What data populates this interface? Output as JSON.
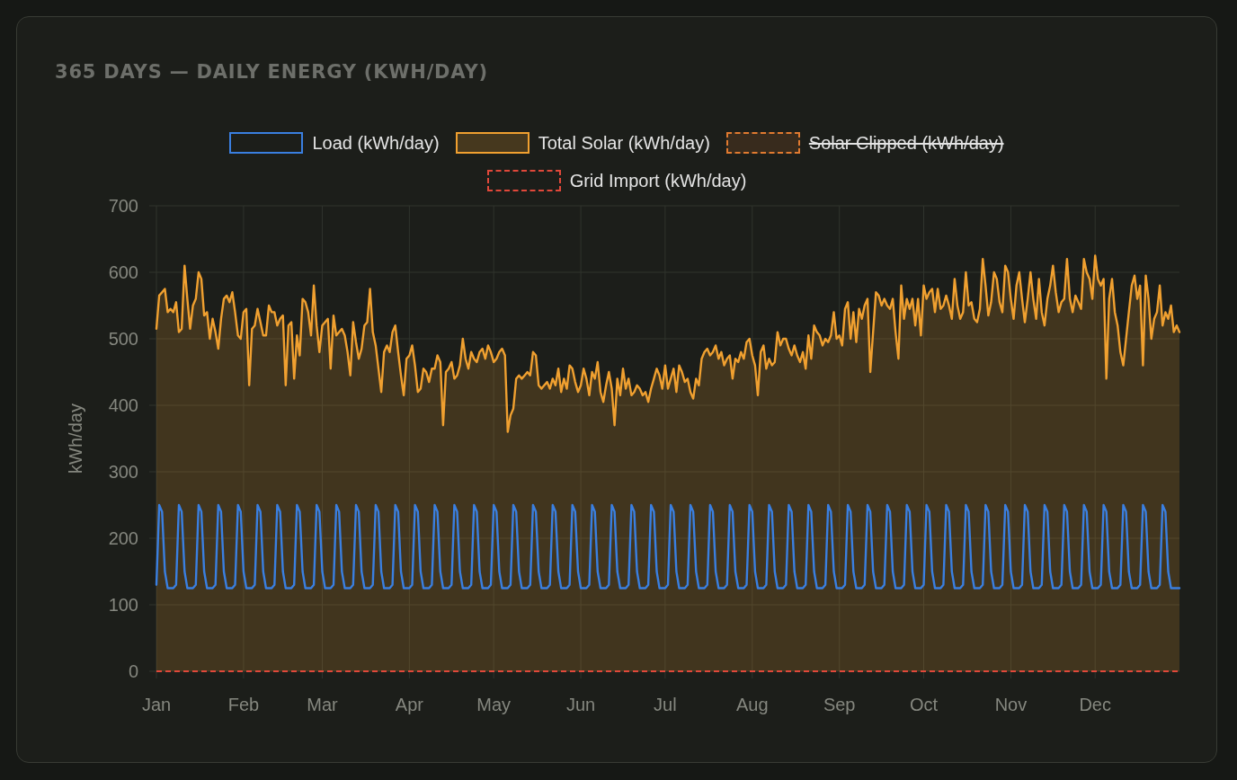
{
  "card": {
    "title": "365 DAYS — DAILY ENERGY (KWH/DAY)",
    "legend": [
      {
        "hidden": false
      },
      {
        "hidden": false
      },
      {
        "hidden": true
      },
      {
        "hidden": false
      }
    ],
    "chart_data": {
      "type": "line",
      "ylabel": "kWh/day",
      "grid": true,
      "ylim": [
        0,
        700
      ],
      "yticks": [
        0,
        100,
        200,
        300,
        400,
        500,
        600,
        700
      ],
      "categories": [
        "Jan",
        null,
        null,
        null,
        null,
        null,
        null,
        null,
        null,
        null,
        null,
        null,
        null,
        null,
        null,
        null,
        null,
        null,
        null,
        null,
        null,
        null,
        null,
        null,
        null,
        null,
        null,
        null,
        null,
        null,
        null,
        "Feb",
        null,
        null,
        null,
        null,
        null,
        null,
        null,
        null,
        null,
        null,
        null,
        null,
        null,
        null,
        null,
        null,
        null,
        null,
        null,
        null,
        null,
        null,
        null,
        null,
        null,
        null,
        null,
        "Mar",
        null,
        null,
        null,
        null,
        null,
        null,
        null,
        null,
        null,
        null,
        null,
        null,
        null,
        null,
        null,
        null,
        null,
        null,
        null,
        null,
        null,
        null,
        null,
        null,
        null,
        null,
        null,
        null,
        null,
        null,
        "Apr",
        null,
        null,
        null,
        null,
        null,
        null,
        null,
        null,
        null,
        null,
        null,
        null,
        null,
        null,
        null,
        null,
        null,
        null,
        null,
        null,
        null,
        null,
        null,
        null,
        null,
        null,
        null,
        null,
        null,
        "May",
        null,
        null,
        null,
        null,
        null,
        null,
        null,
        null,
        null,
        null,
        null,
        null,
        null,
        null,
        null,
        null,
        null,
        null,
        null,
        null,
        null,
        null,
        null,
        null,
        null,
        null,
        null,
        null,
        null,
        null,
        "Jun",
        null,
        null,
        null,
        null,
        null,
        null,
        null,
        null,
        null,
        null,
        null,
        null,
        null,
        null,
        null,
        null,
        null,
        null,
        null,
        null,
        null,
        null,
        null,
        null,
        null,
        null,
        null,
        null,
        null,
        "Jul",
        null,
        null,
        null,
        null,
        null,
        null,
        null,
        null,
        null,
        null,
        null,
        null,
        null,
        null,
        null,
        null,
        null,
        null,
        null,
        null,
        null,
        null,
        null,
        null,
        null,
        null,
        null,
        null,
        null,
        null,
        "Aug",
        null,
        null,
        null,
        null,
        null,
        null,
        null,
        null,
        null,
        null,
        null,
        null,
        null,
        null,
        null,
        null,
        null,
        null,
        null,
        null,
        null,
        null,
        null,
        null,
        null,
        null,
        null,
        null,
        null,
        null,
        "Sep",
        null,
        null,
        null,
        null,
        null,
        null,
        null,
        null,
        null,
        null,
        null,
        null,
        null,
        null,
        null,
        null,
        null,
        null,
        null,
        null,
        null,
        null,
        null,
        null,
        null,
        null,
        null,
        null,
        null,
        "Oct",
        null,
        null,
        null,
        null,
        null,
        null,
        null,
        null,
        null,
        null,
        null,
        null,
        null,
        null,
        null,
        null,
        null,
        null,
        null,
        null,
        null,
        null,
        null,
        null,
        null,
        null,
        null,
        null,
        null,
        null,
        "Nov",
        null,
        null,
        null,
        null,
        null,
        null,
        null,
        null,
        null,
        null,
        null,
        null,
        null,
        null,
        null,
        null,
        null,
        null,
        null,
        null,
        null,
        null,
        null,
        null,
        null,
        null,
        null,
        null,
        null,
        "Dec",
        null,
        null,
        null,
        null,
        null,
        null,
        null,
        null,
        null,
        null,
        null,
        null,
        null,
        null,
        null,
        null,
        null,
        null,
        null,
        null,
        null,
        null,
        null,
        null,
        null,
        null,
        null,
        null,
        null,
        null
      ],
      "series": [
        {
          "name": "Load (kWh/day)",
          "color": "#3a7fe0",
          "type": "line",
          "line_style": "solid",
          "values": [
            130,
            250,
            240,
            150,
            125,
            125,
            125,
            130,
            250,
            240,
            150,
            125,
            125,
            125,
            130,
            250,
            240,
            150,
            125,
            125,
            125,
            130,
            250,
            240,
            150,
            125,
            125,
            125,
            130,
            250,
            240,
            150,
            125,
            125,
            125,
            130,
            250,
            240,
            150,
            125,
            125,
            125,
            130,
            250,
            240,
            150,
            125,
            125,
            125,
            130,
            250,
            240,
            150,
            125,
            125,
            125,
            130,
            250,
            240,
            150,
            125,
            125,
            125,
            130,
            250,
            240,
            150,
            125,
            125,
            125,
            130,
            250,
            240,
            150,
            125,
            125,
            125,
            130,
            250,
            240,
            150,
            125,
            125,
            125,
            130,
            250,
            240,
            150,
            125,
            125,
            125,
            130,
            250,
            240,
            150,
            125,
            125,
            125,
            130,
            250,
            240,
            150,
            125,
            125,
            125,
            130,
            250,
            240,
            150,
            125,
            125,
            125,
            130,
            250,
            240,
            150,
            125,
            125,
            125,
            130,
            250,
            240,
            150,
            125,
            125,
            125,
            130,
            250,
            240,
            150,
            125,
            125,
            125,
            130,
            250,
            240,
            150,
            125,
            125,
            125,
            130,
            250,
            240,
            150,
            125,
            125,
            125,
            130,
            250,
            240,
            150,
            125,
            125,
            125,
            130,
            250,
            240,
            150,
            125,
            125,
            125,
            130,
            250,
            240,
            150,
            125,
            125,
            125,
            130,
            250,
            240,
            150,
            125,
            125,
            125,
            130,
            250,
            240,
            150,
            125,
            125,
            125,
            130,
            250,
            240,
            150,
            125,
            125,
            125,
            130,
            250,
            240,
            150,
            125,
            125,
            125,
            130,
            250,
            240,
            150,
            125,
            125,
            125,
            130,
            250,
            240,
            150,
            125,
            125,
            125,
            130,
            250,
            240,
            150,
            125,
            125,
            125,
            130,
            250,
            240,
            150,
            125,
            125,
            125,
            130,
            250,
            240,
            150,
            125,
            125,
            125,
            130,
            250,
            240,
            150,
            125,
            125,
            125,
            130,
            250,
            240,
            150,
            125,
            125,
            125,
            130,
            250,
            240,
            150,
            125,
            125,
            125,
            130,
            250,
            240,
            150,
            125,
            125,
            125,
            130,
            250,
            240,
            150,
            125,
            125,
            125,
            130,
            250,
            240,
            150,
            125,
            125,
            125,
            130,
            250,
            240,
            150,
            125,
            125,
            125,
            130,
            250,
            240,
            150,
            125,
            125,
            125,
            130,
            250,
            240,
            150,
            125,
            125,
            125,
            130,
            250,
            240,
            150,
            125,
            125,
            125,
            130,
            250,
            240,
            150,
            125,
            125,
            125,
            130,
            250,
            240,
            150,
            125,
            125,
            125,
            130,
            250,
            240,
            150,
            125,
            125,
            125,
            130,
            250,
            240,
            150,
            125,
            125,
            125,
            130,
            250,
            240,
            150,
            125,
            125,
            125,
            130,
            250,
            240,
            150,
            125,
            125,
            125,
            130,
            250,
            240,
            150,
            125,
            125,
            125,
            130,
            250,
            240,
            150,
            125,
            125,
            125,
            130,
            250,
            240,
            150,
            125,
            125,
            125,
            125
          ]
        },
        {
          "name": "Total Solar (kWh/day)",
          "color": "#f0a030",
          "type": "area",
          "line_style": "solid",
          "values": [
            515,
            565,
            570,
            575,
            540,
            545,
            540,
            555,
            510,
            515,
            610,
            560,
            515,
            550,
            560,
            600,
            590,
            535,
            540,
            500,
            530,
            510,
            485,
            530,
            560,
            565,
            555,
            570,
            540,
            505,
            500,
            540,
            545,
            430,
            515,
            520,
            545,
            525,
            505,
            505,
            550,
            540,
            540,
            520,
            530,
            535,
            430,
            520,
            525,
            440,
            505,
            475,
            560,
            555,
            540,
            505,
            580,
            520,
            480,
            520,
            525,
            530,
            455,
            535,
            505,
            510,
            515,
            505,
            480,
            445,
            525,
            495,
            470,
            485,
            520,
            525,
            575,
            510,
            490,
            455,
            420,
            480,
            490,
            480,
            510,
            520,
            480,
            445,
            415,
            470,
            475,
            490,
            460,
            420,
            425,
            455,
            450,
            435,
            455,
            455,
            475,
            465,
            370,
            450,
            455,
            465,
            440,
            445,
            460,
            500,
            470,
            455,
            480,
            470,
            465,
            480,
            485,
            470,
            490,
            480,
            465,
            470,
            480,
            485,
            475,
            360,
            385,
            395,
            440,
            445,
            440,
            445,
            450,
            445,
            480,
            475,
            430,
            425,
            430,
            435,
            425,
            440,
            430,
            455,
            420,
            440,
            425,
            460,
            455,
            435,
            420,
            430,
            455,
            440,
            415,
            450,
            440,
            465,
            420,
            405,
            430,
            450,
            425,
            370,
            440,
            415,
            455,
            425,
            440,
            415,
            420,
            430,
            425,
            415,
            420,
            405,
            425,
            440,
            455,
            445,
            425,
            460,
            425,
            440,
            455,
            420,
            460,
            450,
            435,
            440,
            420,
            410,
            440,
            430,
            470,
            480,
            485,
            475,
            480,
            490,
            470,
            480,
            460,
            470,
            475,
            440,
            470,
            465,
            480,
            470,
            495,
            500,
            475,
            460,
            415,
            480,
            490,
            455,
            470,
            460,
            465,
            510,
            490,
            500,
            500,
            485,
            475,
            490,
            475,
            465,
            480,
            455,
            505,
            470,
            520,
            510,
            505,
            490,
            500,
            495,
            505,
            540,
            500,
            505,
            490,
            545,
            555,
            500,
            540,
            495,
            545,
            530,
            550,
            560,
            450,
            510,
            570,
            565,
            550,
            560,
            550,
            545,
            560,
            510,
            470,
            580,
            530,
            560,
            545,
            560,
            520,
            560,
            505,
            580,
            560,
            570,
            575,
            540,
            575,
            545,
            550,
            565,
            550,
            530,
            590,
            550,
            530,
            540,
            600,
            550,
            555,
            530,
            525,
            545,
            620,
            580,
            535,
            555,
            600,
            590,
            555,
            540,
            610,
            600,
            560,
            530,
            580,
            600,
            560,
            525,
            560,
            600,
            560,
            530,
            590,
            540,
            520,
            560,
            580,
            610,
            570,
            540,
            555,
            560,
            620,
            560,
            540,
            565,
            555,
            545,
            620,
            600,
            590,
            560,
            625,
            590,
            580,
            590,
            440,
            560,
            590,
            540,
            520,
            480,
            460,
            500,
            540,
            580,
            595,
            560,
            580,
            460,
            595,
            560,
            500,
            530,
            540,
            580,
            520,
            540,
            530,
            550,
            510,
            520,
            510
          ]
        },
        {
          "name": "Solar Clipped (kWh/day)",
          "color": "#e07a30",
          "type": "area",
          "line_style": "dashed",
          "values": [
            null,
            null,
            null,
            null,
            null,
            null,
            null,
            null,
            null,
            null,
            null,
            null,
            null,
            null,
            null,
            null,
            null,
            null,
            null,
            null,
            null,
            null,
            null,
            null,
            null,
            null,
            null,
            null,
            null,
            null,
            null,
            null,
            null,
            null,
            null,
            null,
            null,
            null,
            null,
            null,
            null,
            null,
            null,
            null,
            null,
            null,
            null,
            null,
            null,
            null,
            null,
            null,
            null,
            null,
            null,
            null,
            null,
            null,
            null,
            null,
            null,
            null,
            null,
            null,
            null,
            null,
            null,
            null,
            null,
            null,
            null,
            null,
            null,
            null,
            null,
            null,
            null,
            null,
            null,
            null,
            null,
            null,
            null,
            null,
            null,
            null,
            null,
            null,
            null,
            null,
            null,
            null,
            null,
            null,
            null,
            null,
            null,
            null,
            null,
            null,
            null,
            null,
            null,
            null,
            null,
            null,
            null,
            null,
            null,
            null,
            null,
            null,
            null,
            null,
            null,
            null,
            null,
            null,
            null,
            null,
            null,
            null,
            null,
            null,
            null,
            null,
            null,
            null,
            null,
            null,
            null,
            null,
            null,
            null,
            null,
            null,
            null,
            null,
            null,
            null,
            null,
            null,
            null,
            null,
            null,
            null,
            null,
            null,
            null,
            null,
            null,
            null,
            null,
            null,
            null,
            null,
            null,
            null,
            null,
            null,
            null,
            null,
            null,
            null,
            null,
            null,
            null,
            null,
            null,
            null,
            null,
            null,
            null,
            null,
            null,
            null,
            null,
            null,
            null,
            null,
            null,
            null,
            null,
            null,
            null,
            null,
            null,
            null,
            null,
            null,
            null,
            null,
            null,
            null,
            null,
            null,
            null,
            null,
            null,
            null,
            null,
            null,
            null,
            null,
            null,
            null,
            null,
            null,
            null,
            null,
            null,
            null,
            null,
            null,
            null,
            null,
            null,
            null,
            null,
            null,
            null,
            null,
            null,
            null,
            null,
            null,
            null,
            null,
            null,
            null,
            null,
            null,
            null,
            null,
            null,
            null,
            null,
            null,
            null,
            null,
            null,
            null,
            null,
            null,
            null,
            null,
            null,
            null,
            null,
            null,
            null,
            null,
            null,
            null,
            null,
            null,
            null,
            null,
            null,
            null,
            null,
            null,
            null,
            null,
            null,
            null,
            null,
            null,
            null,
            null,
            null,
            null,
            null,
            null,
            null,
            null,
            null,
            null,
            null,
            null,
            null,
            null,
            null,
            null,
            null,
            null,
            null,
            null,
            null,
            null,
            null,
            null,
            null,
            null,
            null,
            null,
            null,
            null,
            null,
            null,
            null,
            null,
            null,
            null,
            null,
            null,
            null,
            null,
            null,
            null,
            null,
            null,
            null,
            null,
            null,
            null,
            null,
            null,
            null,
            null,
            null,
            null,
            null,
            null,
            null,
            null,
            null,
            null,
            null,
            null,
            null,
            null,
            null,
            null,
            null,
            null,
            null,
            null,
            null,
            null,
            null,
            null,
            null,
            null,
            null,
            null,
            null,
            null,
            null,
            null,
            null,
            null,
            null,
            null,
            null,
            null,
            null,
            null,
            null,
            null,
            null,
            null,
            null,
            null,
            null
          ]
        },
        {
          "name": "Grid Import (kWh/day)",
          "color": "#e0483a",
          "type": "line",
          "line_style": "dashed",
          "values": [
            0,
            0,
            0,
            0,
            0,
            0,
            0,
            0,
            0,
            0,
            0,
            0,
            0,
            0,
            0,
            0,
            0,
            0,
            0,
            0,
            0,
            0,
            0,
            0,
            0,
            0,
            0,
            0,
            0,
            0,
            0,
            0,
            0,
            0,
            0,
            0,
            0,
            0,
            0,
            0,
            0,
            0,
            0,
            0,
            0,
            0,
            0,
            0,
            0,
            0,
            0,
            0,
            0,
            0,
            0,
            0,
            0,
            0,
            0,
            0,
            0,
            0,
            0,
            0,
            0,
            0,
            0,
            0,
            0,
            0,
            0,
            0,
            0,
            0,
            0,
            0,
            0,
            0,
            0,
            0,
            0,
            0,
            0,
            0,
            0,
            0,
            0,
            0,
            0,
            0,
            0,
            0,
            0,
            0,
            0,
            0,
            0,
            0,
            0,
            0,
            0,
            0,
            0,
            0,
            0,
            0,
            0,
            0,
            0,
            0,
            0,
            0,
            0,
            0,
            0,
            0,
            0,
            0,
            0,
            0,
            0,
            0,
            0,
            0,
            0,
            0,
            0,
            0,
            0,
            0,
            0,
            0,
            0,
            0,
            0,
            0,
            0,
            0,
            0,
            0,
            0,
            0,
            0,
            0,
            0,
            0,
            0,
            0,
            0,
            0,
            0,
            0,
            0,
            0,
            0,
            0,
            0,
            0,
            0,
            0,
            0,
            0,
            0,
            0,
            0,
            0,
            0,
            0,
            0,
            0,
            0,
            0,
            0,
            0,
            0,
            0,
            0,
            0,
            0,
            0,
            0,
            0,
            0,
            0,
            0,
            0,
            0,
            0,
            0,
            0,
            0,
            0,
            0,
            0,
            0,
            0,
            0,
            0,
            0,
            0,
            0,
            0,
            0,
            0,
            0,
            0,
            0,
            0,
            0,
            0,
            0,
            0,
            0,
            0,
            0,
            0,
            0,
            0,
            0,
            0,
            0,
            0,
            0,
            0,
            0,
            0,
            0,
            0,
            0,
            0,
            0,
            0,
            0,
            0,
            0,
            0,
            0,
            0,
            0,
            0,
            0,
            0,
            0,
            0,
            0,
            0,
            0,
            0,
            0,
            0,
            0,
            0,
            0,
            0,
            0,
            0,
            0,
            0,
            0,
            0,
            0,
            0,
            0,
            0,
            0,
            0,
            0,
            0,
            0,
            0,
            0,
            0,
            0,
            0,
            0,
            0,
            0,
            0,
            0,
            0,
            0,
            0,
            0,
            0,
            0,
            0,
            0,
            0,
            0,
            0,
            0,
            0,
            0,
            0,
            0,
            0,
            0,
            0,
            0,
            0,
            0,
            0,
            0,
            0,
            0,
            0,
            0,
            0,
            0,
            0,
            0,
            0,
            0,
            0,
            0,
            0,
            0,
            0,
            0,
            0,
            0,
            0,
            0,
            0,
            0,
            0,
            0,
            0,
            0,
            0,
            0,
            0,
            0,
            0,
            0,
            0,
            0,
            0,
            0,
            0,
            0,
            0,
            0,
            0,
            0,
            0,
            0,
            0,
            0,
            0,
            0,
            0,
            0,
            0,
            0,
            0,
            0,
            0,
            0,
            0,
            0,
            0,
            0,
            0,
            0
          ]
        }
      ]
    }
  }
}
